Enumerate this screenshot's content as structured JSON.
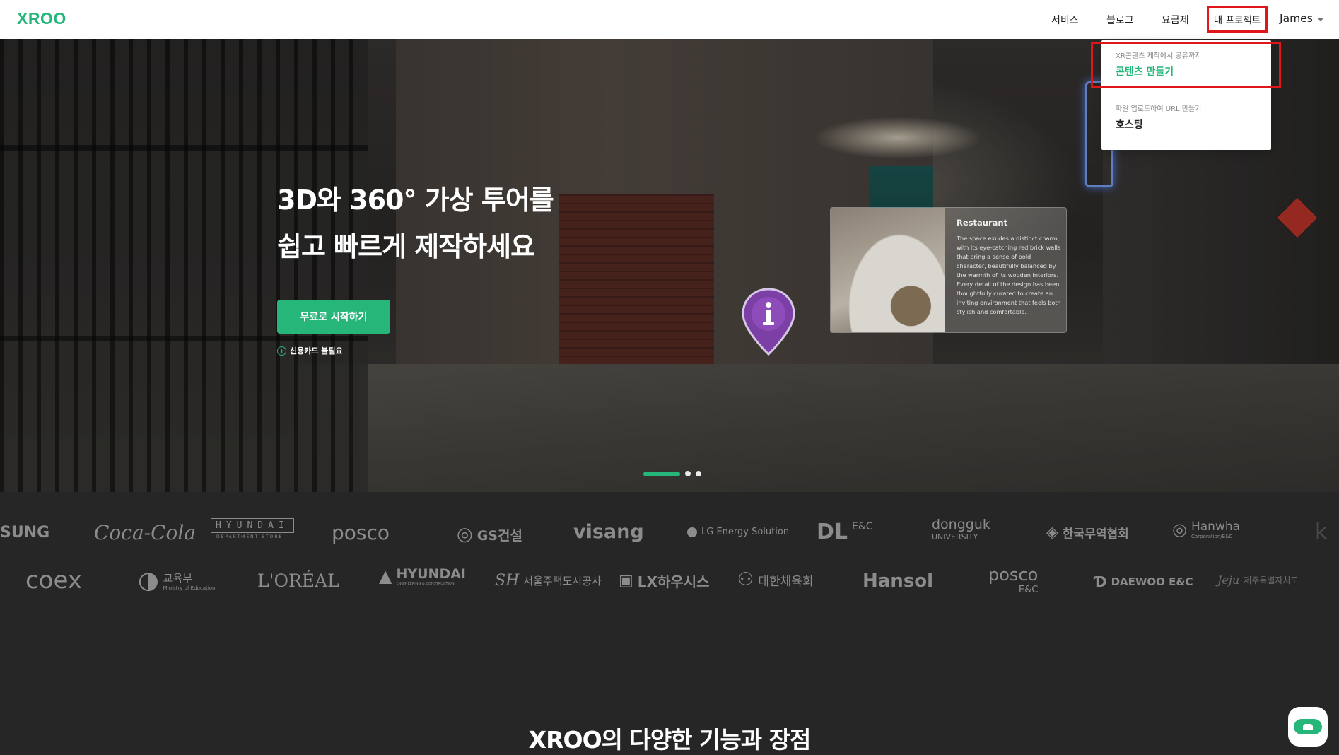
{
  "header": {
    "logo": "XROO",
    "nav": {
      "services": "서비스",
      "blog": "블로그",
      "pricing": "요금제",
      "my_project": "내 프로젝트",
      "user": "James"
    }
  },
  "dropdown": {
    "items": [
      {
        "description": "XR콘텐츠 제작에서 공유까지",
        "label": "콘텐츠 만들기"
      },
      {
        "description": "파일 업로드하여 URL 만들기",
        "label": "호스팅"
      }
    ]
  },
  "hero": {
    "title_line1": "3D와 360° 가상 투어를",
    "title_line2": "쉽고 빠르게 제작하세요",
    "cta": "무료로 시작하기",
    "notice": "신용카드 불필요",
    "card": {
      "title": "Restaurant",
      "text": "The space exudes a distinct charm, with its eye-catching red brick walls that bring a sense of bold character, beautifully balanced by the warmth of its wooden interiors. Every detail of the design has been thoughtfully curated to create an inviting environment that feels both stylish and comfortable."
    },
    "slides_total": 3,
    "slide_active": 1
  },
  "clients": {
    "row1": [
      "SUNG",
      "Coca-Cola",
      "HYUNDAI",
      "DEPARTMENT STORE",
      "posco",
      "GS건설",
      "visang",
      "LG Energy Solution",
      "DL",
      "E&C",
      "dongguk",
      "UNIVERSITY",
      "한국무역협회",
      "Hanwha",
      "Corporation/E&C",
      "k"
    ],
    "row2": [
      "coex",
      "교육부",
      "Ministry of Education",
      "L'ORÉAL",
      "HYUNDAI",
      "ENGINEERING & CONSTRUCTION",
      "서울주택도시공사",
      "LX하우시스",
      "대한체육회",
      "Hansol",
      "posco",
      "E&C",
      "DAEWOO E&C",
      "제주특별자치도"
    ]
  },
  "section_title": "XROO의 다양한 기능과 장점",
  "colors": {
    "brand_green": "#27b679",
    "highlight_red": "#e0161b",
    "dark_bg": "#262626"
  }
}
